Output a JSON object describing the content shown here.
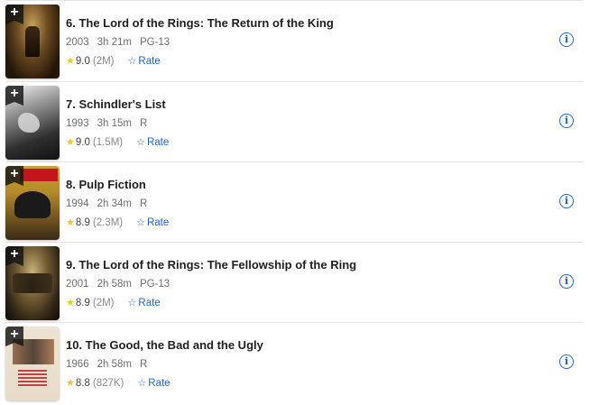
{
  "add_symbol": "+",
  "rate_label": "Rate",
  "star_glyph": "★",
  "rate_star_glyph": "☆",
  "info_glyph": "i",
  "colors": {
    "rating_star": "#f5c518",
    "link_blue": "#1e64c8",
    "title": "#1f1f1f",
    "meta": "#6e6e6e"
  },
  "movies": [
    {
      "title": "6. The Lord of the Rings: The Return of the King",
      "year": "2003",
      "runtime": "3h 21m",
      "certificate": "PG-13",
      "rating": "9.0",
      "votes": "(2M)",
      "poster_icon": "lotr-return-of-the-king-poster"
    },
    {
      "title": "7. Schindler's List",
      "year": "1993",
      "runtime": "3h 15m",
      "certificate": "R",
      "rating": "9.0",
      "votes": "(1.5M)",
      "poster_icon": "schindlers-list-poster"
    },
    {
      "title": "8. Pulp Fiction",
      "year": "1994",
      "runtime": "2h 34m",
      "certificate": "R",
      "rating": "8.9",
      "votes": "(2.3M)",
      "poster_icon": "pulp-fiction-poster"
    },
    {
      "title": "9. The Lord of the Rings: The Fellowship of the Ring",
      "year": "2001",
      "runtime": "2h 58m",
      "certificate": "PG-13",
      "rating": "8.9",
      "votes": "(2M)",
      "poster_icon": "lotr-fellowship-poster"
    },
    {
      "title": "10. The Good, the Bad and the Ugly",
      "year": "1966",
      "runtime": "2h 58m",
      "certificate": "R",
      "rating": "8.8",
      "votes": "(827K)",
      "poster_icon": "good-bad-ugly-poster"
    }
  ]
}
